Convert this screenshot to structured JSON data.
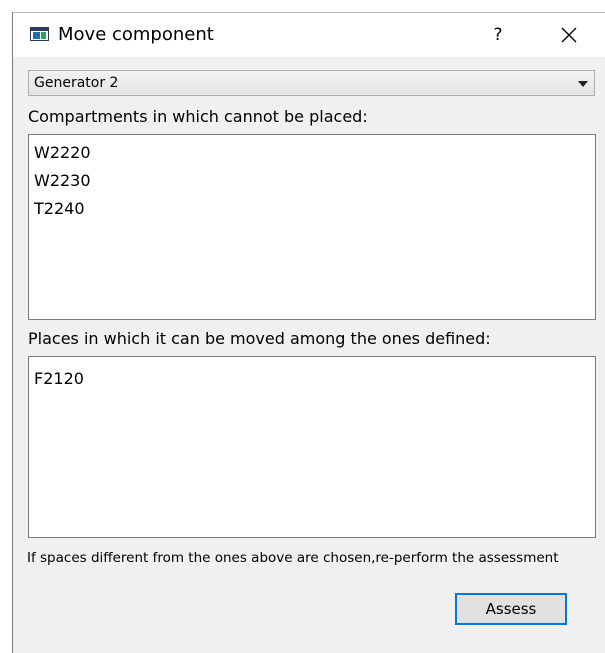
{
  "window": {
    "title": "Move component",
    "help_label": "?"
  },
  "component_select": {
    "selected": "Generator 2"
  },
  "excluded": {
    "label": "Compartments in which cannot be placed:",
    "items": [
      "W2220",
      "W2230",
      "T2240"
    ]
  },
  "allowed": {
    "label": "Places in which it can be moved among the ones defined:",
    "items": [
      "F2120"
    ]
  },
  "note": "If spaces different from the ones above are chosen,re-perform the assessment",
  "actions": {
    "assess_label": "Assess"
  },
  "icons": {
    "app": "window-app-icon",
    "help": "help-icon",
    "close": "close-icon",
    "dropdown": "chevron-down-icon"
  },
  "colors": {
    "accent": "#0078d7",
    "dialog_bg": "#f0f0f0",
    "titlebar_bg": "#ffffff"
  }
}
